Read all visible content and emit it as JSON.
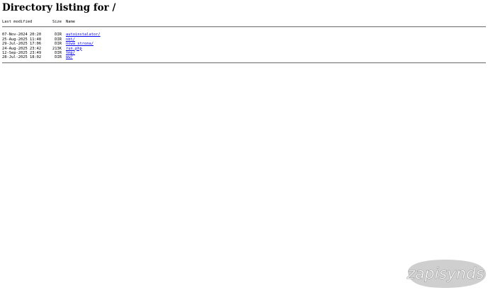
{
  "page": {
    "title": "Directory listing for /"
  },
  "listing": {
    "headers": {
      "modified": "Last modified",
      "size": "Size",
      "name": "Name"
    },
    "entries": [
      {
        "modified": "07-Nov-2024 20:20",
        "size": "DIR",
        "name": "autoinstalator/"
      },
      {
        "modified": "25-Aug-2025 11:48",
        "size": "DIR",
        "name": "nbt/"
      },
      {
        "modified": "29-Jul-2025 17:06",
        "size": "DIR",
        "name": "nowa_strona/"
      },
      {
        "modified": "24-Aug-2025 23:42",
        "size": "213K",
        "name": "run.php"
      },
      {
        "modified": "12-Sep-2025 23:49",
        "size": "DIR",
        "name": "tmp/"
      },
      {
        "modified": "28-Jul-2025 18:02",
        "size": "DIR",
        "name": "ww/"
      }
    ]
  },
  "watermark": {
    "text": "zapisynds",
    "blob_color": "#cfcfcf",
    "text_color": "#ffffff"
  }
}
